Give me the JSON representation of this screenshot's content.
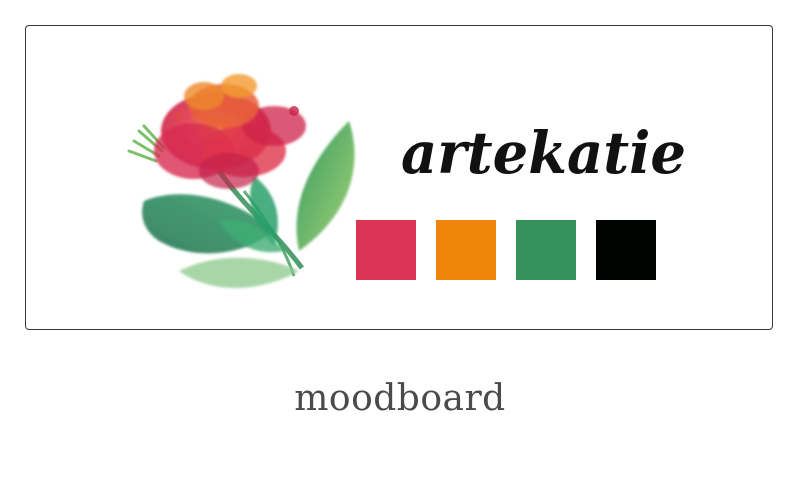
{
  "logo": {
    "text": "artekatie",
    "text_color": "#111111"
  },
  "palette": {
    "swatches": [
      {
        "name": "red",
        "color": "#DC3355"
      },
      {
        "name": "orange",
        "color": "#EE8409"
      },
      {
        "name": "green",
        "color": "#33915A"
      },
      {
        "name": "black",
        "color": "#000400"
      }
    ]
  },
  "caption": "moodboard",
  "icons": {
    "flower": "watercolor-flower-icon"
  }
}
